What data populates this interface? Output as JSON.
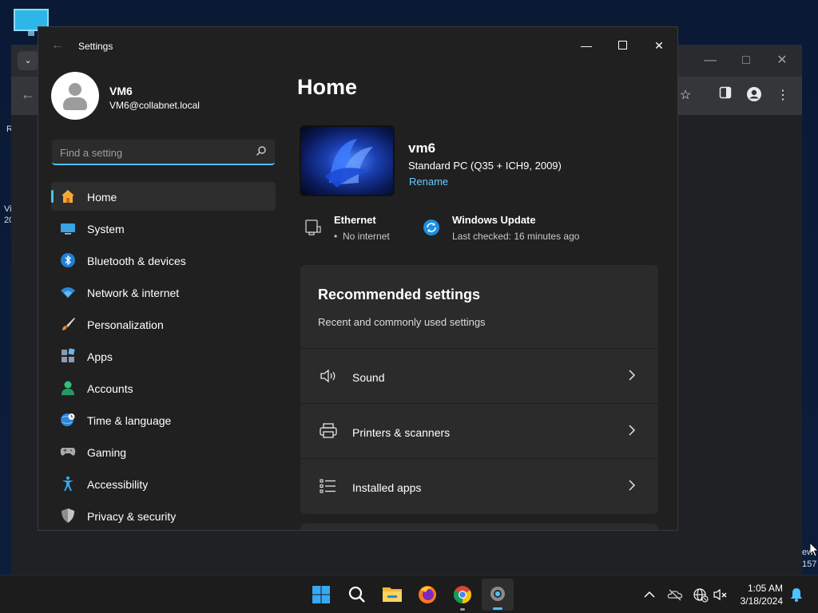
{
  "desktop": {
    "fragments": [
      "R",
      "Vi",
      "20",
      "ew",
      "157"
    ]
  },
  "settings": {
    "title": "Settings",
    "user": {
      "name": "VM6",
      "email": "VM6@collabnet.local"
    },
    "search": {
      "placeholder": "Find a setting"
    },
    "nav": [
      {
        "label": "Home",
        "icon": "home-icon"
      },
      {
        "label": "System",
        "icon": "system-icon"
      },
      {
        "label": "Bluetooth & devices",
        "icon": "bluetooth-icon"
      },
      {
        "label": "Network & internet",
        "icon": "wifi-icon"
      },
      {
        "label": "Personalization",
        "icon": "brush-icon"
      },
      {
        "label": "Apps",
        "icon": "apps-icon"
      },
      {
        "label": "Accounts",
        "icon": "accounts-icon"
      },
      {
        "label": "Time & language",
        "icon": "globe-clock-icon"
      },
      {
        "label": "Gaming",
        "icon": "gamepad-icon"
      },
      {
        "label": "Accessibility",
        "icon": "accessibility-icon"
      },
      {
        "label": "Privacy & security",
        "icon": "shield-icon"
      }
    ],
    "page_title": "Home",
    "device": {
      "name": "vm6",
      "model": "Standard PC (Q35 + ICH9, 2009)",
      "rename_label": "Rename"
    },
    "status": {
      "ethernet": {
        "title": "Ethernet",
        "sub": "No internet"
      },
      "update": {
        "title": "Windows Update",
        "sub": "Last checked: 16 minutes ago"
      }
    },
    "recommended": {
      "title": "Recommended settings",
      "subtitle": "Recent and commonly used settings",
      "items": [
        {
          "label": "Sound",
          "icon": "speaker-icon"
        },
        {
          "label": "Printers & scanners",
          "icon": "printer-icon"
        },
        {
          "label": "Installed apps",
          "icon": "list-icon"
        }
      ]
    }
  },
  "taskbar": {
    "clock": {
      "time": "1:05 AM",
      "date": "3/18/2024"
    }
  },
  "colors": {
    "accent": "#4cc2ff",
    "link": "#60cdff",
    "window_bg": "#202020",
    "card_bg": "#2b2b2b"
  }
}
